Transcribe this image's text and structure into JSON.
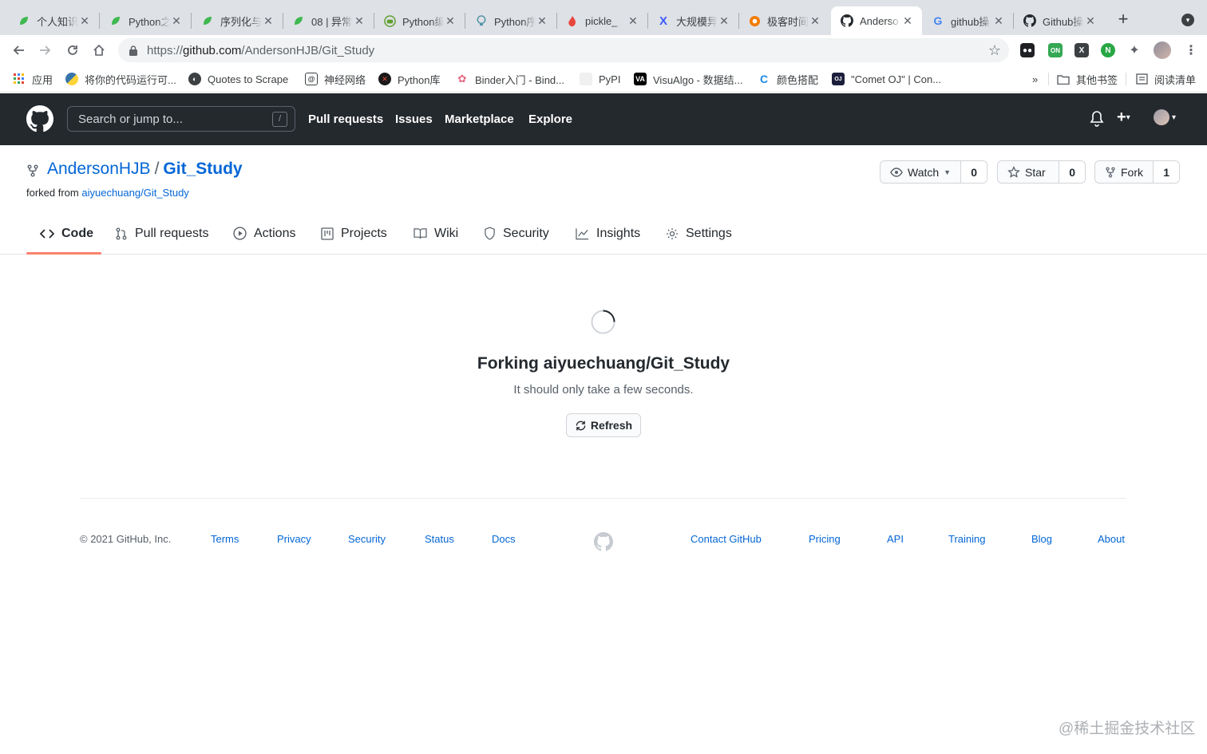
{
  "browser": {
    "tabs": [
      {
        "title": "个人知识",
        "icon": "leaf-icon"
      },
      {
        "title": "Python之",
        "icon": "leaf-icon"
      },
      {
        "title": "序列化与",
        "icon": "leaf-icon"
      },
      {
        "title": "08 | 异常",
        "icon": "leaf-icon"
      },
      {
        "title": "Python编",
        "icon": "robot-icon"
      },
      {
        "title": "Python序",
        "icon": "bulb-icon"
      },
      {
        "title": "pickle_",
        "icon": "flame-icon"
      },
      {
        "title": "大规模异",
        "icon": "x-icon"
      },
      {
        "title": "极客时间",
        "icon": "geek-icon"
      },
      {
        "title": "Anderso",
        "icon": "github-icon"
      },
      {
        "title": "github操",
        "icon": "google-icon"
      },
      {
        "title": "Github操",
        "icon": "github-icon"
      }
    ],
    "active_tab_index": 9,
    "url": {
      "scheme": "https://",
      "host": "github.com",
      "path": "/AndersonHJB/Git_Study"
    },
    "extensions": [
      {
        "name": "bitwarden-ext-icon",
        "color": "#202124"
      },
      {
        "name": "on-ext-icon",
        "color": "#34a853",
        "badge": "ON"
      },
      {
        "name": "x-ext-icon",
        "color": "#3c4043"
      },
      {
        "name": "green-ext-icon",
        "color": "#28a745"
      },
      {
        "name": "puzzle-ext-icon",
        "color": "#5f6368"
      }
    ],
    "bookmarks": [
      {
        "label": "应用",
        "icon": "apps-grid-icon"
      },
      {
        "label": "将你的代码运行可...",
        "icon": "python-icon"
      },
      {
        "label": "Quotes to Scrape",
        "icon": "globe-icon"
      },
      {
        "label": "神经网络",
        "icon": "spiral-icon"
      },
      {
        "label": "Python库",
        "icon": "python-lib-icon"
      },
      {
        "label": "Binder入门 - Bind...",
        "icon": "binder-icon"
      },
      {
        "label": "PyPI",
        "icon": "pypi-icon"
      },
      {
        "label": "VisuAlgo - 数据结...",
        "icon": "visualgo-icon"
      },
      {
        "label": "颜色搭配",
        "icon": "color-icon"
      },
      {
        "label": "\"Comet OJ\" | Con...",
        "icon": "cometoj-icon"
      }
    ],
    "bookmarks_more": "»",
    "other_bookmarks": "其他书签",
    "reading_list": "阅读清单"
  },
  "github": {
    "search_placeholder": "Search or jump to...",
    "search_shortcut": "/",
    "nav": [
      "Pull requests",
      "Issues",
      "Marketplace",
      "Explore"
    ],
    "repo": {
      "owner": "AndersonHJB",
      "separator": "/",
      "name": "Git_Study",
      "forked_prefix": "forked from",
      "forked_source": "aiyuechuang/Git_Study"
    },
    "buttons": {
      "watch": {
        "label": "Watch",
        "count": "0"
      },
      "star": {
        "label": "Star",
        "count": "0"
      },
      "fork": {
        "label": "Fork",
        "count": "1"
      }
    },
    "tabs": [
      "Code",
      "Pull requests",
      "Actions",
      "Projects",
      "Wiki",
      "Security",
      "Insights",
      "Settings"
    ],
    "selected_tab": "Code",
    "forking": {
      "heading": "Forking aiyuechuang/Git_Study",
      "subtext": "It should only take a few seconds.",
      "refresh_label": "Refresh"
    },
    "footer": {
      "copyright": "© 2021 GitHub, Inc.",
      "left_links": [
        "Terms",
        "Privacy",
        "Security",
        "Status",
        "Docs"
      ],
      "right_links": [
        "Contact GitHub",
        "Pricing",
        "API",
        "Training",
        "Blog",
        "About"
      ]
    }
  },
  "watermark": "@稀土掘金技术社区",
  "colors": {
    "accent_link": "#0366d6",
    "header_bg": "#24292e",
    "tab_underline": "#f9826c"
  }
}
